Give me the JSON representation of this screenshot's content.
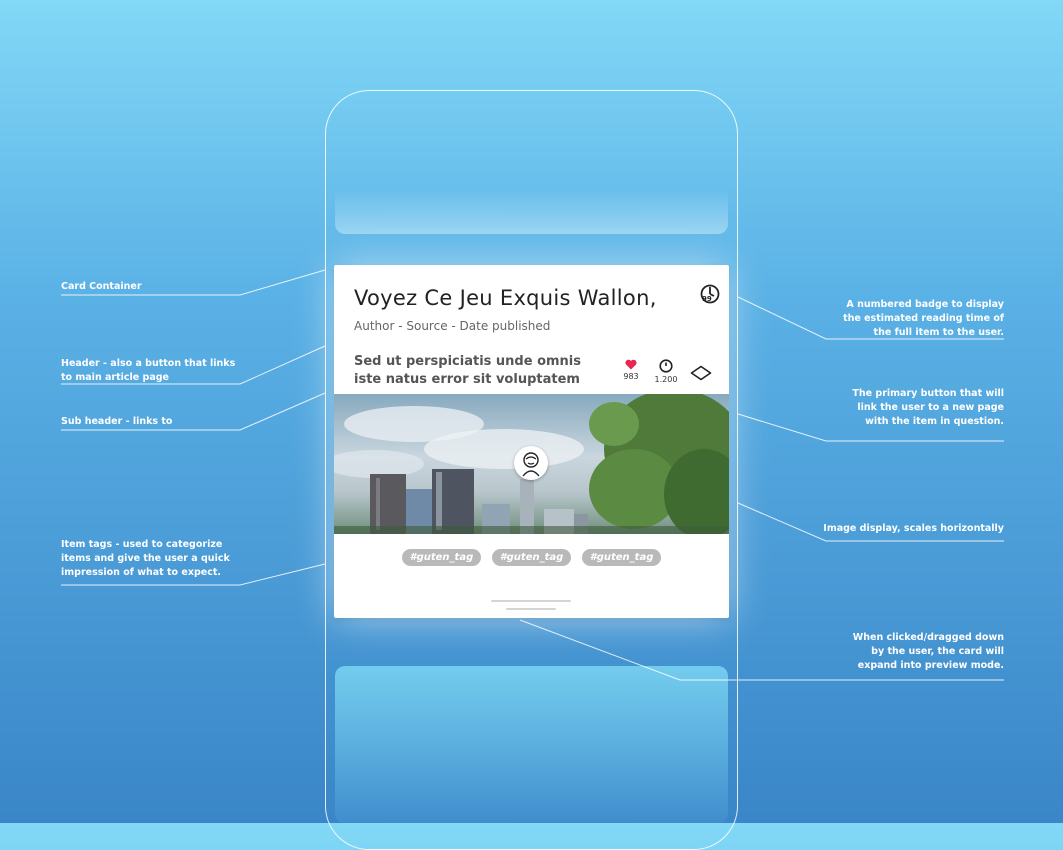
{
  "card": {
    "title": "Voyez Ce Jeu Exquis Wallon,",
    "subtitle": "Author - Source - Date published",
    "description": "Sed ut perspiciatis unde omnis iste natus error sit voluptatem",
    "reading_time_badge": "99",
    "likes": "983",
    "views": "1.200",
    "tags": [
      "#guten_tag",
      "#guten_tag",
      "#guten_tag"
    ]
  },
  "annotations": {
    "card_container": "Card Container",
    "header": "Header - also a button that links to main article page",
    "sub_header": "Sub header - links to",
    "item_tags": "Item tags - used to categorize items and give the user a quick impression of what to expect.",
    "reading_badge": "A numbered badge to display the estimated reading time of the full item to the user.",
    "primary_button": "The primary button that will link the user to  a new page with the item in question.",
    "image_display": "Image display, scales horizontally",
    "expand": "When  clicked/dragged down by the user, the card will expand into preview mode."
  },
  "icons": {
    "like": "heart-icon",
    "views": "clock-icon",
    "open": "diamond-button-icon",
    "reading_time": "timer-icon",
    "avatar": "avatar-icon"
  },
  "colors": {
    "accent_like": "#e8264f",
    "tag_bg": "#b9b9b9"
  }
}
